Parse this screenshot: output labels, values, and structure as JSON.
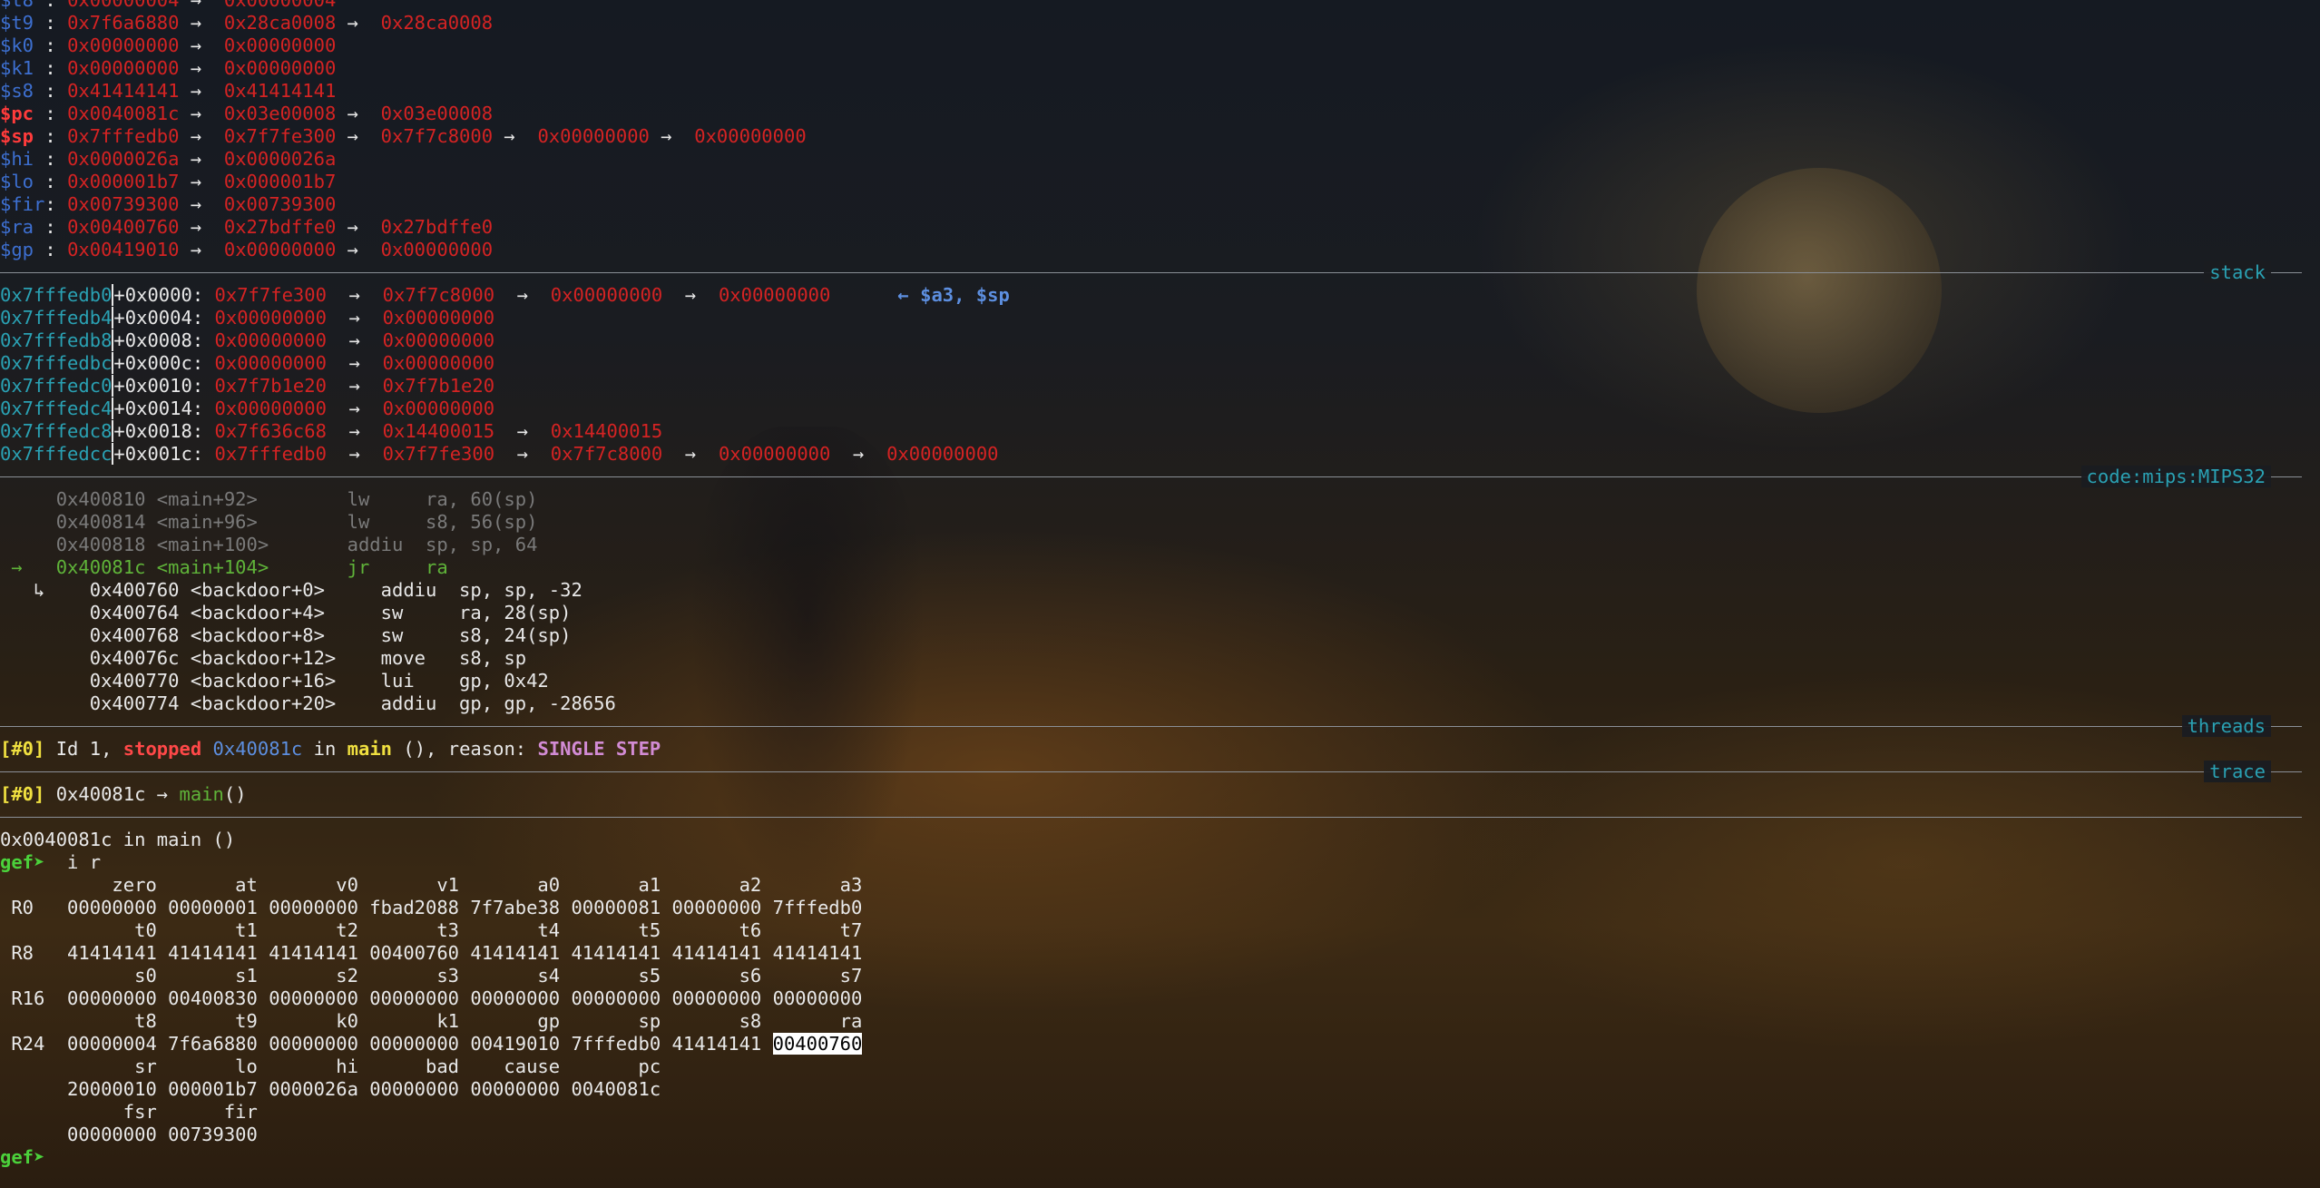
{
  "registers": [
    {
      "name": "$t8 ",
      "hot": false,
      "chain": [
        "0x00000004",
        "0x00000004"
      ]
    },
    {
      "name": "$t9 ",
      "hot": false,
      "chain": [
        "0x7f6a6880",
        "0x28ca0008",
        "0x28ca0008"
      ]
    },
    {
      "name": "$k0 ",
      "hot": false,
      "chain": [
        "0x00000000",
        "0x00000000"
      ]
    },
    {
      "name": "$k1 ",
      "hot": false,
      "chain": [
        "0x00000000",
        "0x00000000"
      ]
    },
    {
      "name": "$s8 ",
      "hot": false,
      "chain": [
        "0x41414141",
        "0x41414141"
      ]
    },
    {
      "name": "$pc ",
      "hot": true,
      "chain": [
        "0x0040081c",
        "0x03e00008",
        "0x03e00008"
      ]
    },
    {
      "name": "$sp ",
      "hot": true,
      "chain": [
        "0x7fffedb0",
        "0x7f7fe300",
        "0x7f7c8000",
        "0x00000000",
        "0x00000000"
      ]
    },
    {
      "name": "$hi ",
      "hot": false,
      "chain": [
        "0x0000026a",
        "0x0000026a"
      ]
    },
    {
      "name": "$lo ",
      "hot": false,
      "chain": [
        "0x000001b7",
        "0x000001b7"
      ]
    },
    {
      "name": "$fir",
      "hot": false,
      "chain": [
        "0x00739300",
        "0x00739300"
      ]
    },
    {
      "name": "$ra ",
      "hot": false,
      "chain": [
        "0x00400760",
        "0x27bdffe0",
        "0x27bdffe0"
      ]
    },
    {
      "name": "$gp ",
      "hot": false,
      "chain": [
        "0x00419010",
        "0x00000000",
        "0x00000000"
      ]
    }
  ],
  "arrow": "→",
  "sections": {
    "stack": "stack",
    "code": "code:mips:MIPS32",
    "threads": "threads",
    "trace": "trace"
  },
  "stack": [
    {
      "addr": "0x7fffedb0",
      "off": "+0x0000:",
      "chain": [
        "0x7f7fe300",
        "0x7f7c8000",
        "0x00000000",
        "0x00000000"
      ],
      "note": "      ← $a3, $sp"
    },
    {
      "addr": "0x7fffedb4",
      "off": "+0x0004:",
      "chain": [
        "0x00000000",
        "0x00000000"
      ],
      "note": ""
    },
    {
      "addr": "0x7fffedb8",
      "off": "+0x0008:",
      "chain": [
        "0x00000000",
        "0x00000000"
      ],
      "note": ""
    },
    {
      "addr": "0x7fffedbc",
      "off": "+0x000c:",
      "chain": [
        "0x00000000",
        "0x00000000"
      ],
      "note": ""
    },
    {
      "addr": "0x7fffedc0",
      "off": "+0x0010:",
      "chain": [
        "0x7f7b1e20",
        "0x7f7b1e20"
      ],
      "note": ""
    },
    {
      "addr": "0x7fffedc4",
      "off": "+0x0014:",
      "chain": [
        "0x00000000",
        "0x00000000"
      ],
      "note": ""
    },
    {
      "addr": "0x7fffedc8",
      "off": "+0x0018:",
      "chain": [
        "0x7f636c68",
        "0x14400015",
        "0x14400015"
      ],
      "note": ""
    },
    {
      "addr": "0x7fffedcc",
      "off": "+0x001c:",
      "chain": [
        "0x7fffedb0",
        "0x7f7fe300",
        "0x7f7c8000",
        "0x00000000",
        "0x00000000"
      ],
      "note": ""
    }
  ],
  "code_past": [
    "     0x400810 <main+92>        lw     ra, 60(sp)",
    "     0x400814 <main+96>        lw     s8, 56(sp)",
    "     0x400818 <main+100>       addiu  sp, sp, 64"
  ],
  "code_current": " →   0x40081c <main+104>       jr     ra",
  "code_branch": [
    "   ↳    0x400760 <backdoor+0>     addiu  sp, sp, -32",
    "        0x400764 <backdoor+4>     sw     ra, 28(sp)",
    "        0x400768 <backdoor+8>     sw     s8, 24(sp)",
    "        0x40076c <backdoor+12>    move   s8, sp",
    "        0x400770 <backdoor+16>    lui    gp, 0x42",
    "        0x400774 <backdoor+20>    addiu  gp, gp, -28656"
  ],
  "thread": {
    "idx": "[#0]",
    "id": " Id 1, ",
    "state": "stopped",
    "addr": "0x40081c",
    "in": " in ",
    "func": "main",
    "rest": " (), reason: ",
    "reason": "SINGLE STEP"
  },
  "trace": {
    "idx": "[#0]",
    "addr": " 0x40081c → ",
    "func": "main",
    "rest": "()"
  },
  "console": {
    "location": "0x0040081c in main ()",
    "prompt": "gef➤ ",
    "command": " i r",
    "table": [
      "          zero       at       v0       v1       a0       a1       a2       a3",
      " R0   00000000 00000001 00000000 fbad2088 7f7abe38 00000081 00000000 7fffedb0",
      "            t0       t1       t2       t3       t4       t5       t6       t7",
      " R8   41414141 41414141 41414141 00400760 41414141 41414141 41414141 41414141",
      "            s0       s1       s2       s3       s4       s5       s6       s7",
      " R16  00000000 00400830 00000000 00000000 00000000 00000000 00000000 00000000",
      "            t8       t9       k0       k1       gp       sp       s8       ra"
    ],
    "r24_prefix": " R24  00000004 7f6a6880 00000000 00000000 00419010 7fffedb0 41414141 ",
    "r24_highlight": "00400760",
    "table_tail": [
      "            sr       lo       hi      bad    cause       pc",
      "      20000010 000001b7 0000026a 00000000 00000000 0040081c",
      "           fsr      fir",
      "      00000000 00739300"
    ]
  }
}
